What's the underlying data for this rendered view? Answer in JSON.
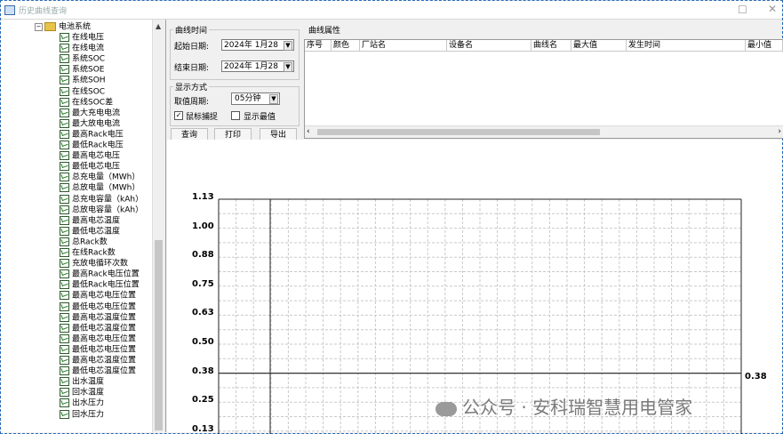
{
  "window": {
    "title": "历史曲线查询",
    "maximize_glyph": "☐",
    "close_glyph": "✕"
  },
  "tree": {
    "expander": "−",
    "parent_label": "电池系统",
    "scroll_up": "▲",
    "items": [
      "在线电压",
      "在线电流",
      "系统SOC",
      "系统SOE",
      "系统SOH",
      "在线SOC",
      "在线SOC差",
      "最大充电电流",
      "最大放电电流",
      "最高Rack电压",
      "最低Rack电压",
      "最高电芯电压",
      "最低电芯电压",
      "总充电量（MWh）",
      "总放电量（MWh）",
      "总充电容量（kAh）",
      "总放电容量（kAh）",
      "最高电芯温度",
      "最低电芯温度",
      "总Rack数",
      "在线Rack数",
      "充放电循环次数",
      "最高Rack电压位置",
      "最低Rack电压位置",
      "最高电芯电压位置",
      "最低电芯电压位置",
      "最高电芯温度位置",
      "最低电芯温度位置",
      "最高电芯电压位置",
      "最低电芯电压位置",
      "最高电芯温度位置",
      "最低电芯温度位置",
      "出水温度",
      "回水温度",
      "出水压力",
      "回水压力"
    ]
  },
  "curve_time": {
    "group_label": "曲线时间",
    "start_label": "起始日期:",
    "start_value": "2024年  1月28",
    "end_label": "结束日期:",
    "end_value": "2024年  1月28"
  },
  "display_mode": {
    "group_label": "显示方式",
    "period_label": "取值周期:",
    "period_value": "05分钟",
    "mouse_capture_label": "鼠标捕捉",
    "mouse_capture_checked": true,
    "show_extreme_label": "显示最值",
    "show_extreme_checked": false
  },
  "buttons": {
    "query": "查询",
    "print": "打印",
    "export": "导出"
  },
  "curve_props": {
    "group_label": "曲线属性",
    "columns": [
      "序号",
      "颜色",
      "厂站名",
      "设备名",
      "曲线名",
      "最大值",
      "发生时间",
      "最小值"
    ],
    "scroll_left": "‹",
    "scroll_right": "›"
  },
  "chart_data": {
    "type": "line",
    "y_ticks": [
      "1.13",
      "1.00",
      "0.88",
      "0.75",
      "0.63",
      "0.50",
      "0.38",
      "0.25",
      "0.13"
    ],
    "ylim": [
      0.13,
      1.13
    ],
    "series": [
      {
        "values": [
          0.38
        ]
      }
    ],
    "line_label": "0.38",
    "grid": true
  },
  "watermark": "公众号 · 安科瑞智慧用电管家"
}
